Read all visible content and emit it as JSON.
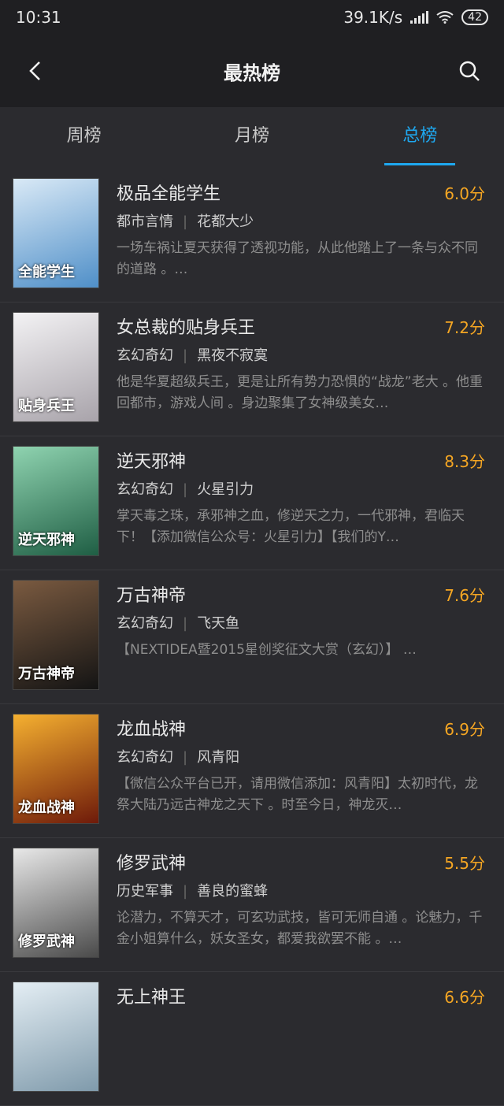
{
  "status": {
    "time": "10:31",
    "speed": "39.1K/s",
    "battery": "42"
  },
  "header": {
    "title": "最热榜"
  },
  "tabs": [
    {
      "label": "周榜"
    },
    {
      "label": "月榜"
    },
    {
      "label": "总榜"
    }
  ],
  "books": [
    {
      "title": "极品全能学生",
      "score": "6.0分",
      "category": "都市言情",
      "author": "花都大少",
      "desc": "一场车祸让夏天获得了透视功能，从此他踏上了一条与众不同的道路 。…",
      "cover_text": "全能学生",
      "cover_color": "#4f8fc8"
    },
    {
      "title": "女总裁的贴身兵王",
      "score": "7.2分",
      "category": "玄幻奇幻",
      "author": "黑夜不寂寞",
      "desc": "他是华夏超级兵王，更是让所有势力恐惧的“战龙”老大 。他重回都市，游戏人间 。身边聚集了女神级美女…",
      "cover_text": "贴身兵王",
      "cover_color": "#d9d6dc"
    },
    {
      "title": "逆天邪神",
      "score": "8.3分",
      "category": "玄幻奇幻",
      "author": "火星引力",
      "desc": "掌天毒之珠，承邪神之血，修逆天之力，一代邪神，君临天下！【添加微信公众号：火星引力】【我们的Y…",
      "cover_text": "逆天邪神",
      "cover_color": "#2f8a62"
    },
    {
      "title": "万古神帝",
      "score": "7.6分",
      "category": "玄幻奇幻",
      "author": "飞天鱼",
      "desc": "【NEXTIDEA暨2015星创奖征文大赏（玄幻）】 …",
      "cover_text": "万古神帝",
      "cover_color": "#3a2a22"
    },
    {
      "title": "龙血战神",
      "score": "6.9分",
      "category": "玄幻奇幻",
      "author": "风青阳",
      "desc": "【微信公众平台已开，请用微信添加：风青阳】太初时代，龙祭大陆乃远古神龙之天下 。时至今日，神龙灭…",
      "cover_text": "龙血战神",
      "cover_color": "#b2361a"
    },
    {
      "title": "修罗武神",
      "score": "5.5分",
      "category": "历史军事",
      "author": "善良的蜜蜂",
      "desc": "论潜力，不算天才，可玄功武技，皆可无师自通 。论魅力，千金小姐算什么，妖女圣女，都爱我欲罢不能 。…",
      "cover_text": "修罗武神",
      "cover_color": "#6d6d6d"
    },
    {
      "title": "无上神王",
      "score": "6.6分",
      "category": "",
      "author": "",
      "desc": "",
      "cover_text": "",
      "cover_color": "#9fb8c8"
    }
  ]
}
